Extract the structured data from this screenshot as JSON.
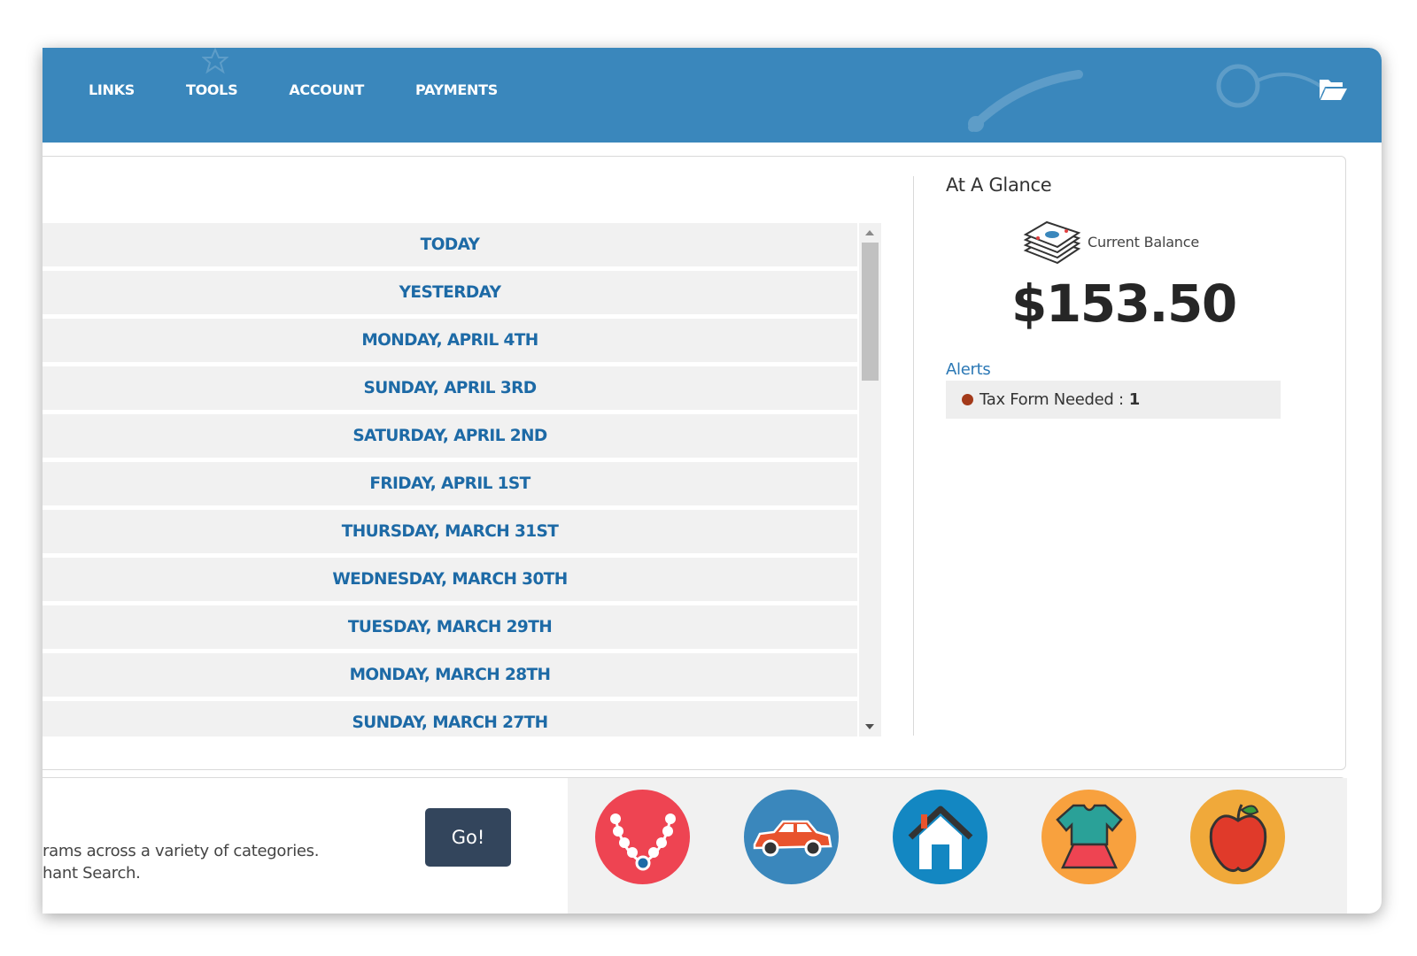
{
  "nav": {
    "links": [
      "LINKS",
      "TOOLS",
      "ACCOUNT",
      "PAYMENTS"
    ],
    "folder_icon": "folder-open-icon"
  },
  "days": [
    "TODAY",
    "YESTERDAY",
    "MONDAY, APRIL 4TH",
    "SUNDAY, APRIL 3RD",
    "SATURDAY, APRIL 2ND",
    "FRIDAY, APRIL 1ST",
    "THURSDAY, MARCH 31ST",
    "WEDNESDAY, MARCH 30TH",
    "TUESDAY, MARCH 29TH",
    "MONDAY, MARCH 28TH",
    "SUNDAY, MARCH 27TH"
  ],
  "glance": {
    "title": "At A Glance",
    "balance_label": "Current Balance",
    "balance_value": "$153.50",
    "alerts_label": "Alerts",
    "alert_text": "Tax Form Needed :",
    "alert_count": "1"
  },
  "bottom": {
    "desc_line1": "rams across a variety of categories.",
    "desc_line2": "hant Search.",
    "go_label": "Go!",
    "categories": [
      {
        "icon": "necklace-icon",
        "color": "#ee4452"
      },
      {
        "icon": "car-icon",
        "color": "#3a87bc"
      },
      {
        "icon": "house-icon",
        "color": "#1387c2"
      },
      {
        "icon": "clothing-icon",
        "color": "#f8a13e"
      },
      {
        "icon": "apple-icon",
        "color": "#f0a93a"
      }
    ]
  },
  "colors": {
    "header": "#3a87bc",
    "day_text": "#1d6aa6",
    "go_button": "#33455c",
    "alert_dot": "#a33a1a"
  }
}
